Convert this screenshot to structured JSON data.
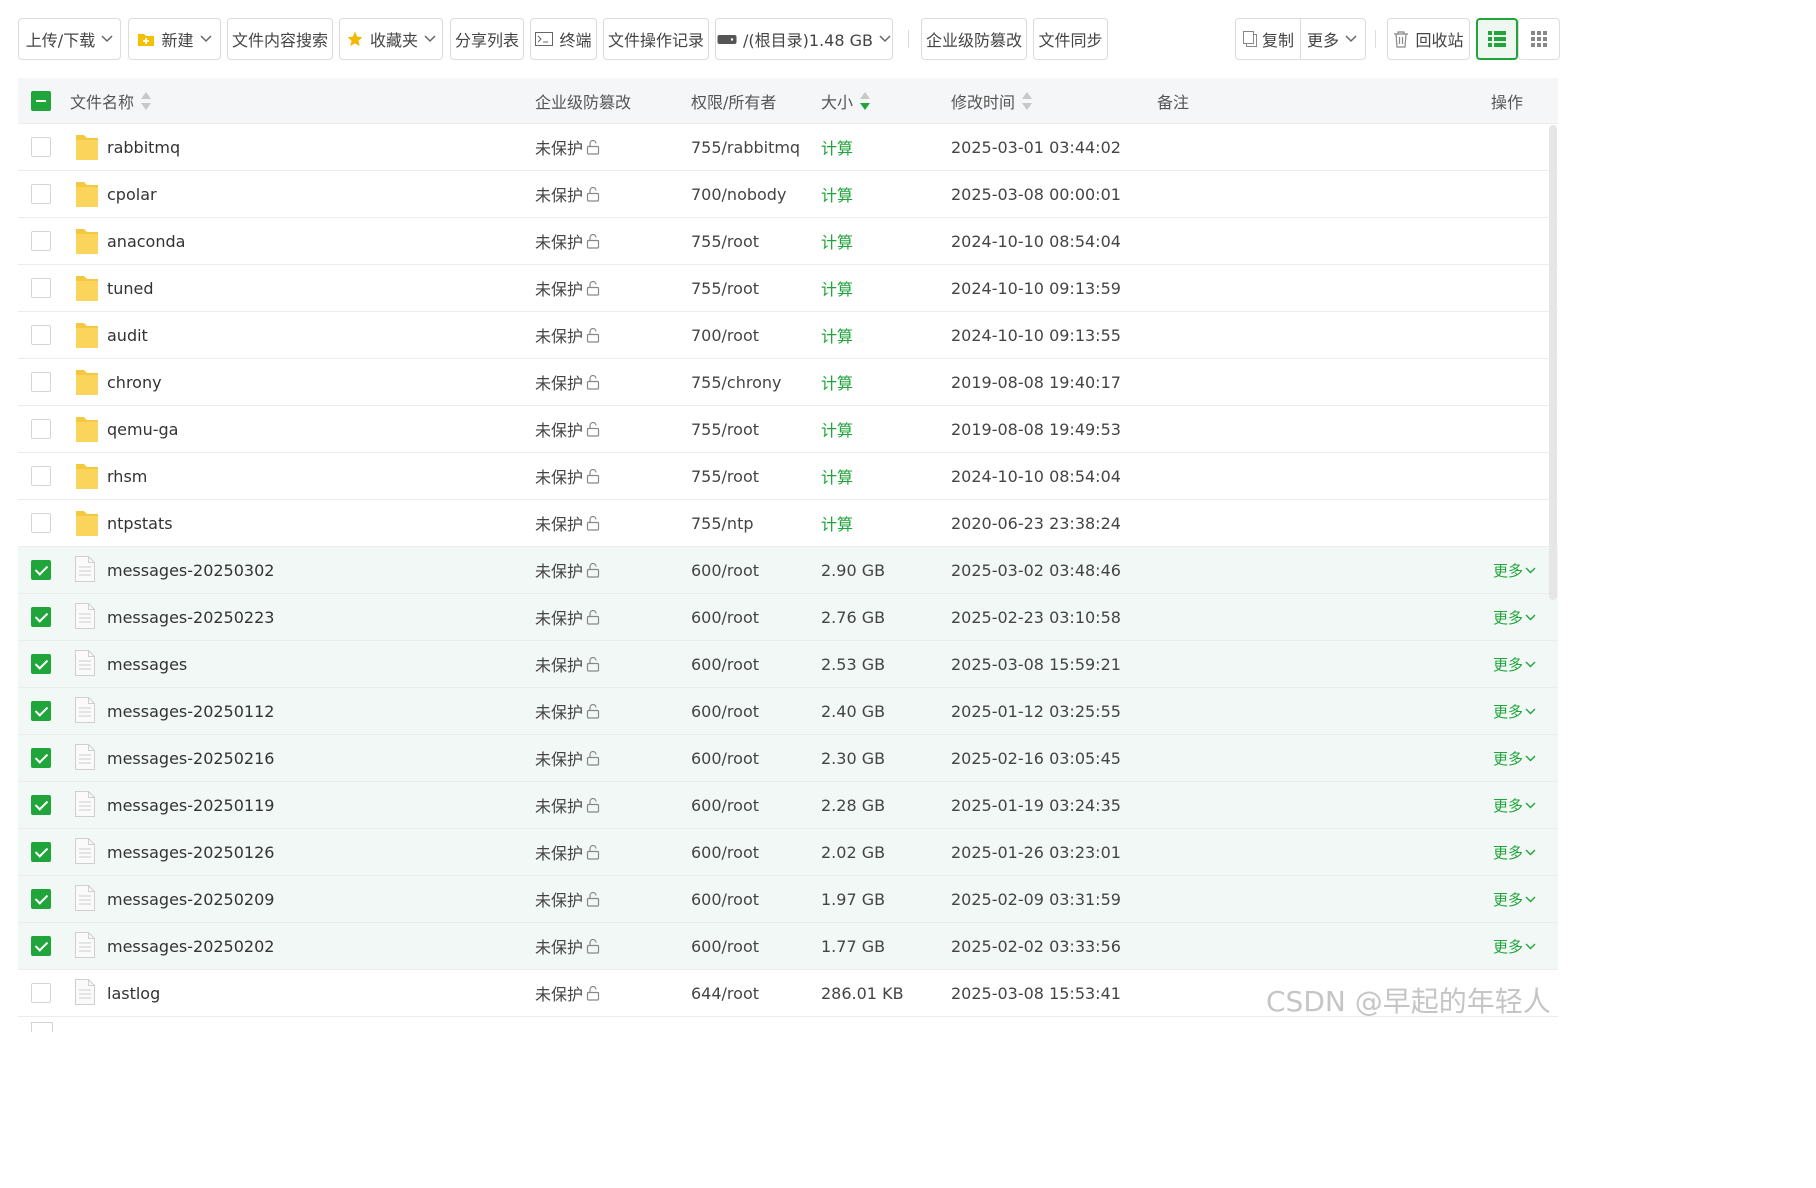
{
  "toolbar": {
    "upload_download": "上传/下载",
    "new": "新建",
    "content_search": "文件内容搜索",
    "favorites": "收藏夹",
    "share_list": "分享列表",
    "terminal": "终端",
    "op_log": "文件操作记录",
    "disk": "/(根目录)1.48 GB",
    "tamper_protect": "企业级防篡改",
    "file_sync": "文件同步",
    "copy": "复制",
    "more": "更多",
    "recycle_bin": "回收站"
  },
  "table": {
    "headers": {
      "name": "文件名称",
      "tamper": "企业级防篡改",
      "perm_owner": "权限/所有者",
      "size": "大小",
      "mtime": "修改时间",
      "note": "备注",
      "ops": "操作"
    },
    "rows": [
      {
        "type": "folder",
        "selected": false,
        "name": "rabbitmq",
        "protect": "未保护",
        "perm": "755/rabbitmq",
        "size": "计算",
        "mtime": "2025-03-01 03:44:02",
        "more": ""
      },
      {
        "type": "folder",
        "selected": false,
        "name": "cpolar",
        "protect": "未保护",
        "perm": "700/nobody",
        "size": "计算",
        "mtime": "2025-03-08 00:00:01",
        "more": ""
      },
      {
        "type": "folder",
        "selected": false,
        "name": "anaconda",
        "protect": "未保护",
        "perm": "755/root",
        "size": "计算",
        "mtime": "2024-10-10 08:54:04",
        "more": ""
      },
      {
        "type": "folder",
        "selected": false,
        "name": "tuned",
        "protect": "未保护",
        "perm": "755/root",
        "size": "计算",
        "mtime": "2024-10-10 09:13:59",
        "more": ""
      },
      {
        "type": "folder",
        "selected": false,
        "name": "audit",
        "protect": "未保护",
        "perm": "700/root",
        "size": "计算",
        "mtime": "2024-10-10 09:13:55",
        "more": ""
      },
      {
        "type": "folder",
        "selected": false,
        "name": "chrony",
        "protect": "未保护",
        "perm": "755/chrony",
        "size": "计算",
        "mtime": "2019-08-08 19:40:17",
        "more": ""
      },
      {
        "type": "folder",
        "selected": false,
        "name": "qemu-ga",
        "protect": "未保护",
        "perm": "755/root",
        "size": "计算",
        "mtime": "2019-08-08 19:49:53",
        "more": ""
      },
      {
        "type": "folder",
        "selected": false,
        "name": "rhsm",
        "protect": "未保护",
        "perm": "755/root",
        "size": "计算",
        "mtime": "2024-10-10 08:54:04",
        "more": ""
      },
      {
        "type": "folder",
        "selected": false,
        "name": "ntpstats",
        "protect": "未保护",
        "perm": "755/ntp",
        "size": "计算",
        "mtime": "2020-06-23 23:38:24",
        "more": ""
      },
      {
        "type": "file",
        "selected": true,
        "name": "messages-20250302",
        "protect": "未保护",
        "perm": "600/root",
        "size": "2.90 GB",
        "mtime": "2025-03-02 03:48:46",
        "more": "更多"
      },
      {
        "type": "file",
        "selected": true,
        "name": "messages-20250223",
        "protect": "未保护",
        "perm": "600/root",
        "size": "2.76 GB",
        "mtime": "2025-02-23 03:10:58",
        "more": "更多"
      },
      {
        "type": "file",
        "selected": true,
        "name": "messages",
        "protect": "未保护",
        "perm": "600/root",
        "size": "2.53 GB",
        "mtime": "2025-03-08 15:59:21",
        "more": "更多"
      },
      {
        "type": "file",
        "selected": true,
        "name": "messages-20250112",
        "protect": "未保护",
        "perm": "600/root",
        "size": "2.40 GB",
        "mtime": "2025-01-12 03:25:55",
        "more": "更多"
      },
      {
        "type": "file",
        "selected": true,
        "name": "messages-20250216",
        "protect": "未保护",
        "perm": "600/root",
        "size": "2.30 GB",
        "mtime": "2025-02-16 03:05:45",
        "more": "更多"
      },
      {
        "type": "file",
        "selected": true,
        "name": "messages-20250119",
        "protect": "未保护",
        "perm": "600/root",
        "size": "2.28 GB",
        "mtime": "2025-01-19 03:24:35",
        "more": "更多"
      },
      {
        "type": "file",
        "selected": true,
        "name": "messages-20250126",
        "protect": "未保护",
        "perm": "600/root",
        "size": "2.02 GB",
        "mtime": "2025-01-26 03:23:01",
        "more": "更多"
      },
      {
        "type": "file",
        "selected": true,
        "name": "messages-20250209",
        "protect": "未保护",
        "perm": "600/root",
        "size": "1.97 GB",
        "mtime": "2025-02-09 03:31:59",
        "more": "更多"
      },
      {
        "type": "file",
        "selected": true,
        "name": "messages-20250202",
        "protect": "未保护",
        "perm": "600/root",
        "size": "1.77 GB",
        "mtime": "2025-02-02 03:33:56",
        "more": "更多"
      },
      {
        "type": "file",
        "selected": false,
        "name": "lastlog",
        "protect": "未保护",
        "perm": "644/root",
        "size": "286.01 KB",
        "mtime": "2025-03-08 15:53:41",
        "more": ""
      }
    ]
  },
  "watermark": "CSDN @早起的年轻人",
  "colors": {
    "accent": "#20a53a",
    "selected_row": "#f1f8f5",
    "header_bg": "#f4f6f8",
    "folder": "#f5c842"
  }
}
